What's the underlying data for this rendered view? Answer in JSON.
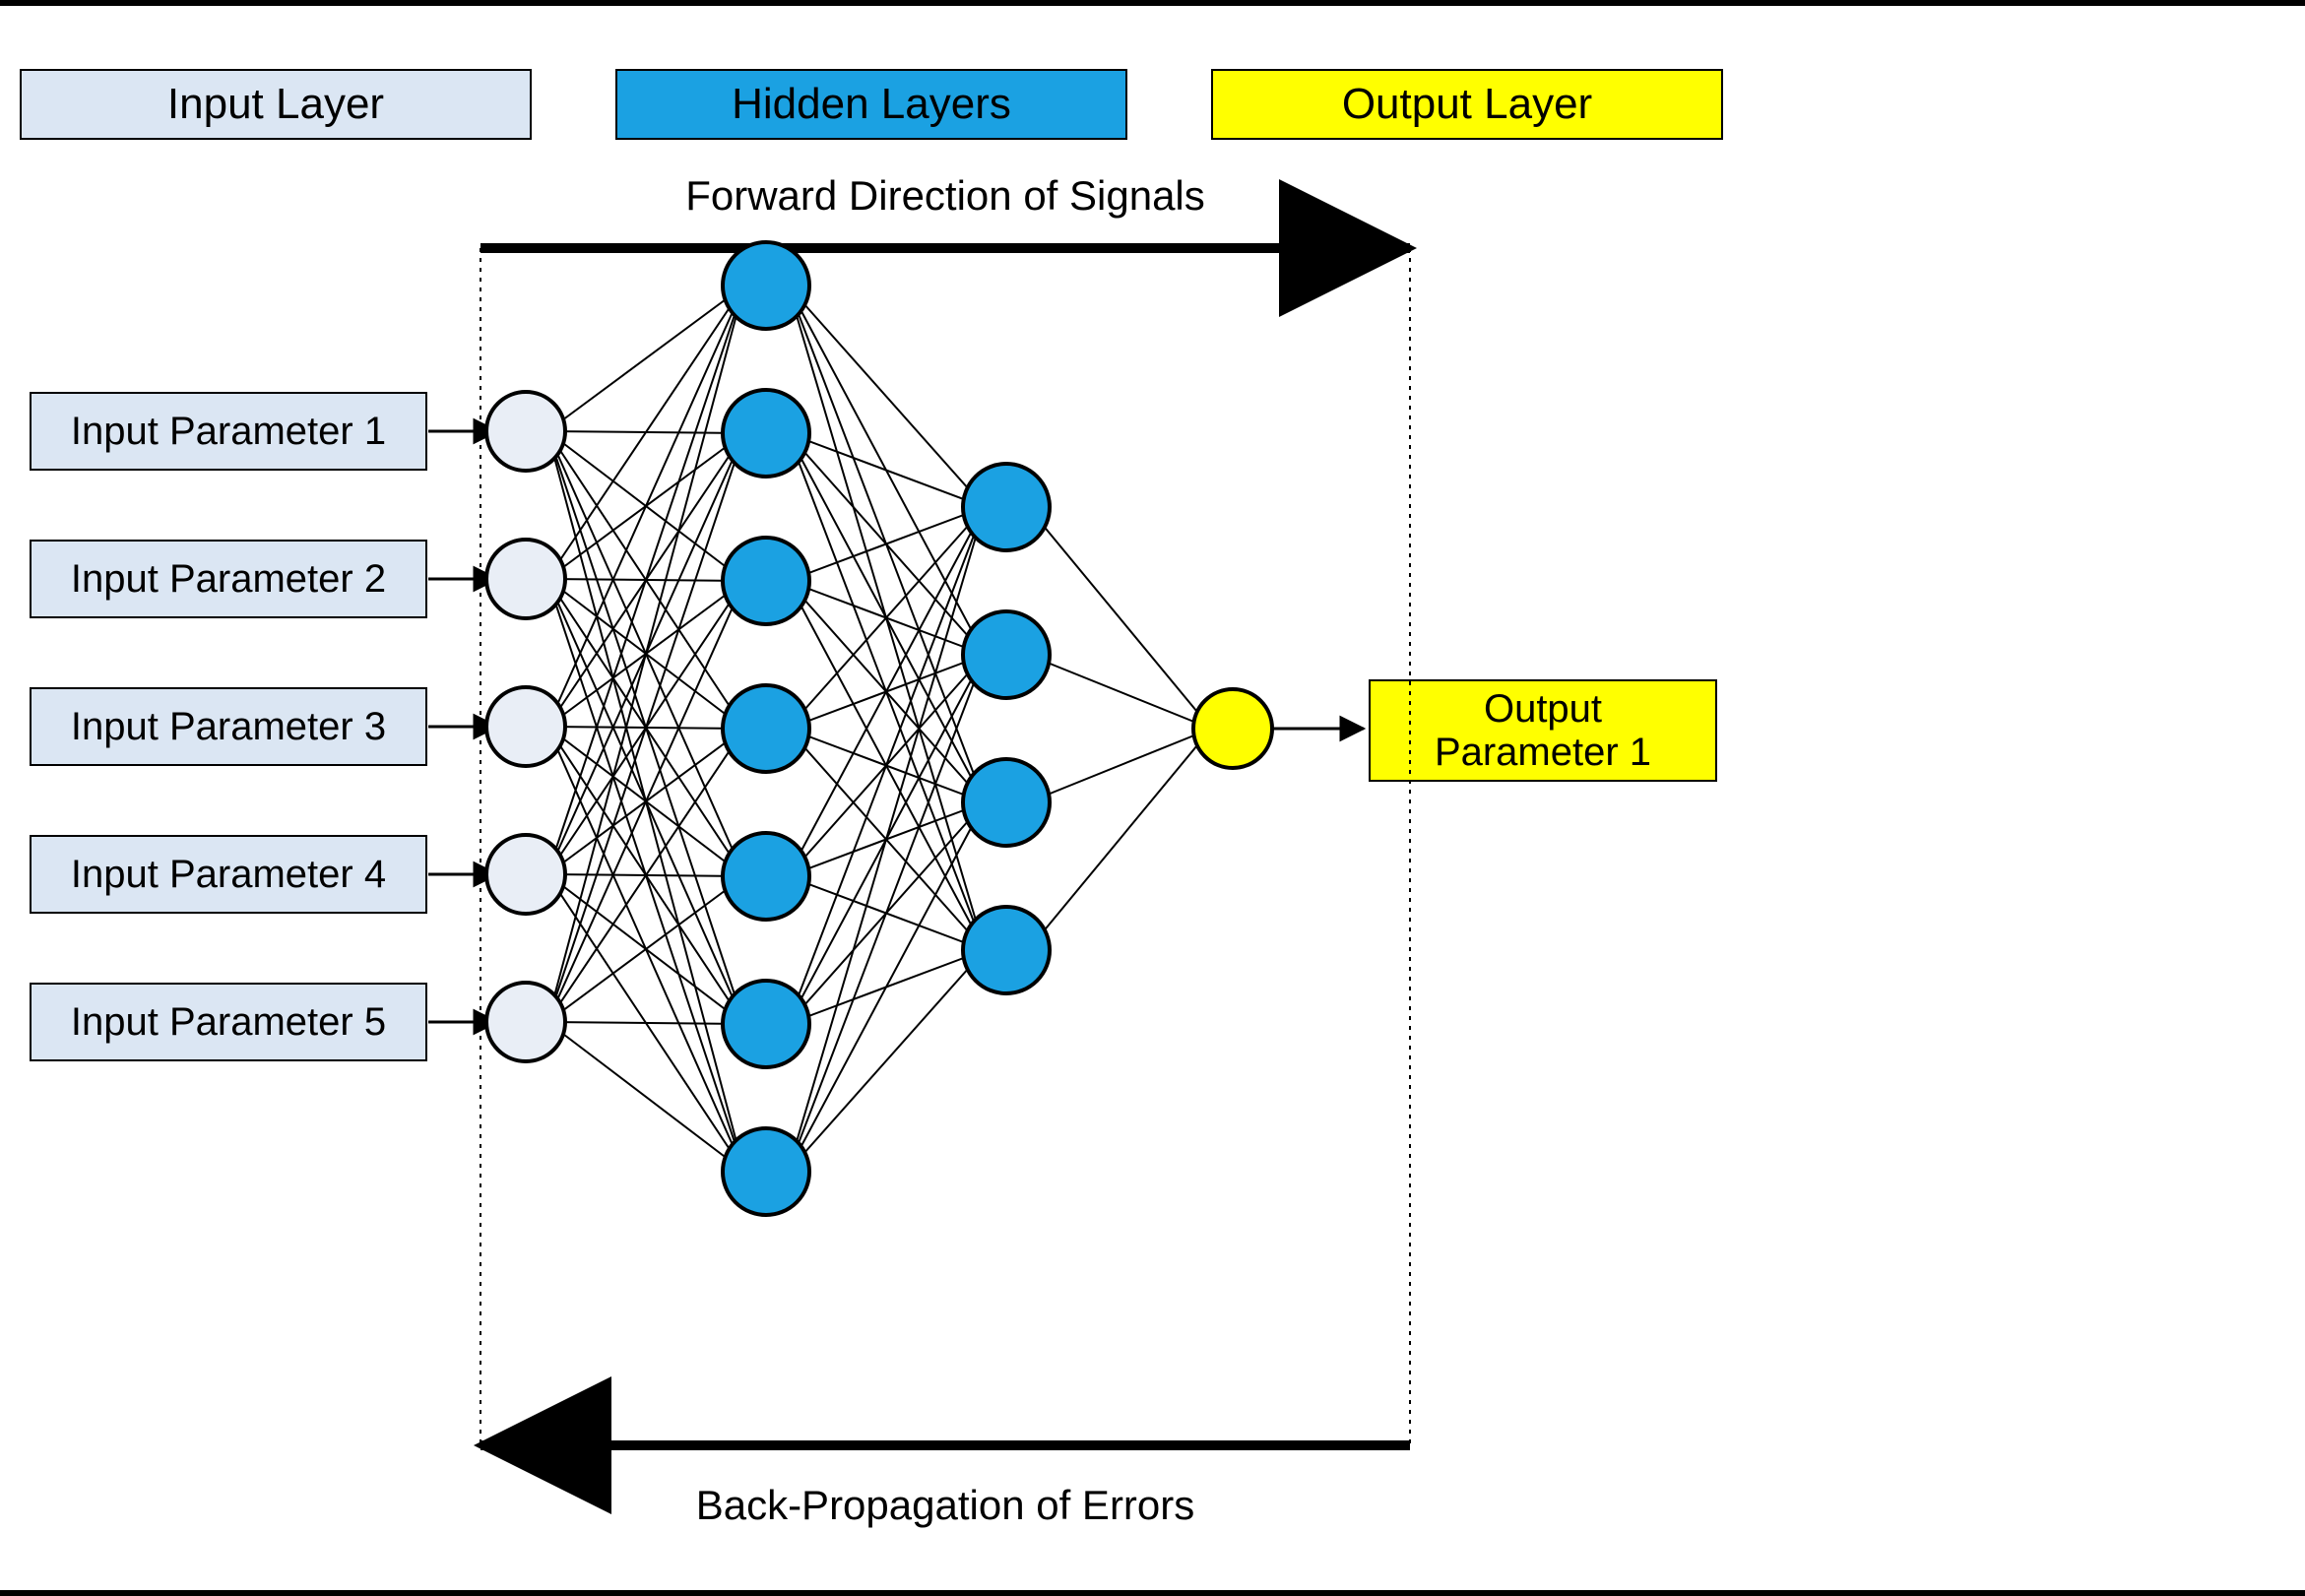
{
  "headers": {
    "input": "Input Layer",
    "hidden": "Hidden Layers",
    "output": "Output Layer"
  },
  "annotations": {
    "forward": "Forward Direction of Signals",
    "backward": "Back-Propagation of Errors"
  },
  "inputs": [
    "Input Parameter 1",
    "Input Parameter 2",
    "Input Parameter 3",
    "Input Parameter 4",
    "Input Parameter 5"
  ],
  "outputs": [
    "Output\nParameter 1"
  ],
  "architecture": {
    "input_nodes": 5,
    "hidden_layers": [
      7,
      4
    ],
    "output_nodes": 1
  },
  "colors": {
    "input_header_fill": "#dbe6f3",
    "hidden_header_fill": "#1ba1e2",
    "output_header_fill": "#ffff00",
    "input_node_fill": "#e9eef6",
    "hidden_node_fill": "#1ba1e2",
    "output_node_fill": "#ffff00",
    "param_box_fill": "#dbe6f3"
  }
}
